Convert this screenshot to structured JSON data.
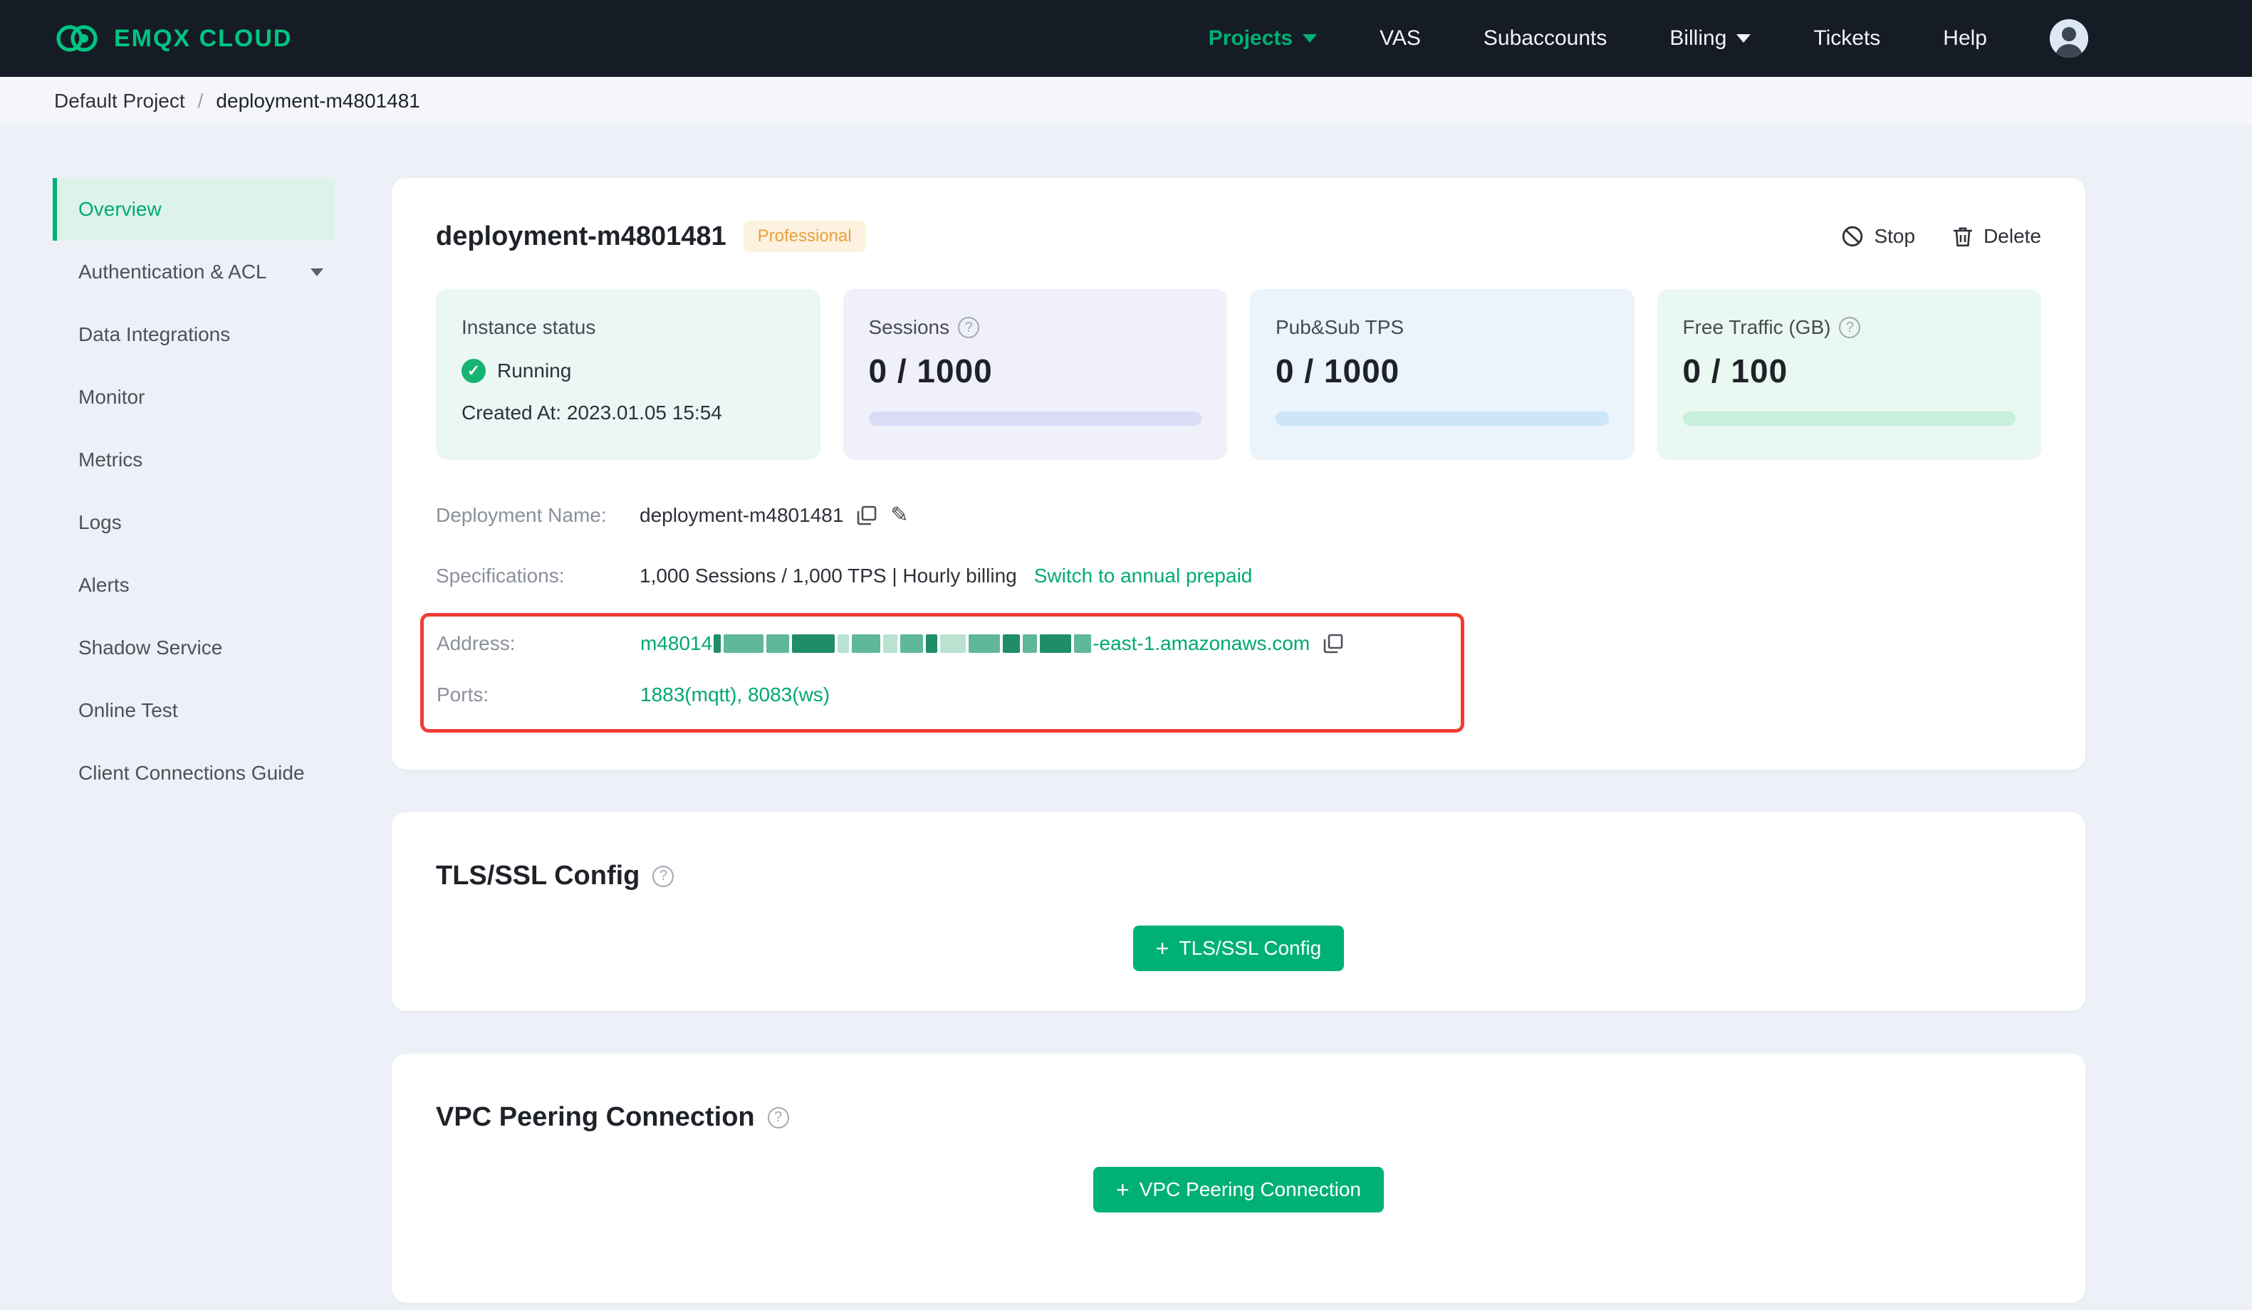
{
  "nav": {
    "brand": "EMQX CLOUD",
    "items": [
      {
        "label": "Projects",
        "active": true,
        "dropdown": true
      },
      {
        "label": "VAS"
      },
      {
        "label": "Subaccounts"
      },
      {
        "label": "Billing",
        "dropdown": true
      },
      {
        "label": "Tickets"
      },
      {
        "label": "Help"
      }
    ]
  },
  "breadcrumb": {
    "project": "Default Project",
    "separator": "/",
    "current": "deployment-m4801481"
  },
  "sidebar": {
    "items": [
      {
        "label": "Overview",
        "active": true
      },
      {
        "label": "Authentication & ACL",
        "dropdown": true
      },
      {
        "label": "Data Integrations"
      },
      {
        "label": "Monitor"
      },
      {
        "label": "Metrics"
      },
      {
        "label": "Logs"
      },
      {
        "label": "Alerts"
      },
      {
        "label": "Shadow Service"
      },
      {
        "label": "Online Test"
      },
      {
        "label": "Client Connections Guide"
      }
    ]
  },
  "deployment": {
    "title": "deployment-m4801481",
    "plan_badge": "Professional",
    "actions": {
      "stop": "Stop",
      "delete": "Delete"
    },
    "stats": [
      {
        "label": "Instance status",
        "status": "Running",
        "created": "Created At: 2023.01.05 15:54"
      },
      {
        "label": "Sessions",
        "value": "0 / 1000",
        "help": true
      },
      {
        "label": "Pub&Sub TPS",
        "value": "0 / 1000"
      },
      {
        "label": "Free Traffic (GB)",
        "value": "0 / 100",
        "help": true
      }
    ],
    "details": {
      "deployment_name_label": "Deployment Name:",
      "deployment_name": "deployment-m4801481",
      "specifications_label": "Specifications:",
      "specifications": "1,000 Sessions / 1,000 TPS | Hourly billing",
      "switch_link": "Switch to annual prepaid",
      "address_label": "Address:",
      "address_prefix": "m48014",
      "address_suffix": "-east-1.amazonaws.com",
      "address_redacted": true,
      "address_redacted_blocks": [
        [
          5,
          2
        ],
        [
          28,
          1
        ],
        [
          16,
          1
        ],
        [
          30,
          2
        ],
        [
          8,
          0
        ],
        [
          20,
          1
        ],
        [
          10,
          0
        ],
        [
          16,
          1
        ],
        [
          8,
          2
        ],
        [
          18,
          0
        ],
        [
          22,
          1
        ],
        [
          12,
          2
        ],
        [
          10,
          1
        ],
        [
          22,
          2
        ],
        [
          12,
          1
        ]
      ],
      "ports_label": "Ports:",
      "ports": "1883(mqtt), 8083(ws)"
    }
  },
  "tls_section": {
    "title": "TLS/SSL Config",
    "button_label": "TLS/SSL Config"
  },
  "vpc_section": {
    "title": "VPC Peering Connection",
    "button_label": "VPC Peering Connection"
  },
  "icons": {
    "plus": "+",
    "help": "?",
    "check": "✓",
    "pencil": "✎"
  },
  "colors": {
    "brand_green": "#00b173",
    "nav_bg": "#151c26",
    "badge_orange": "#e6a23c",
    "annotation_red": "#f23c32",
    "status_green": "#17b373"
  }
}
